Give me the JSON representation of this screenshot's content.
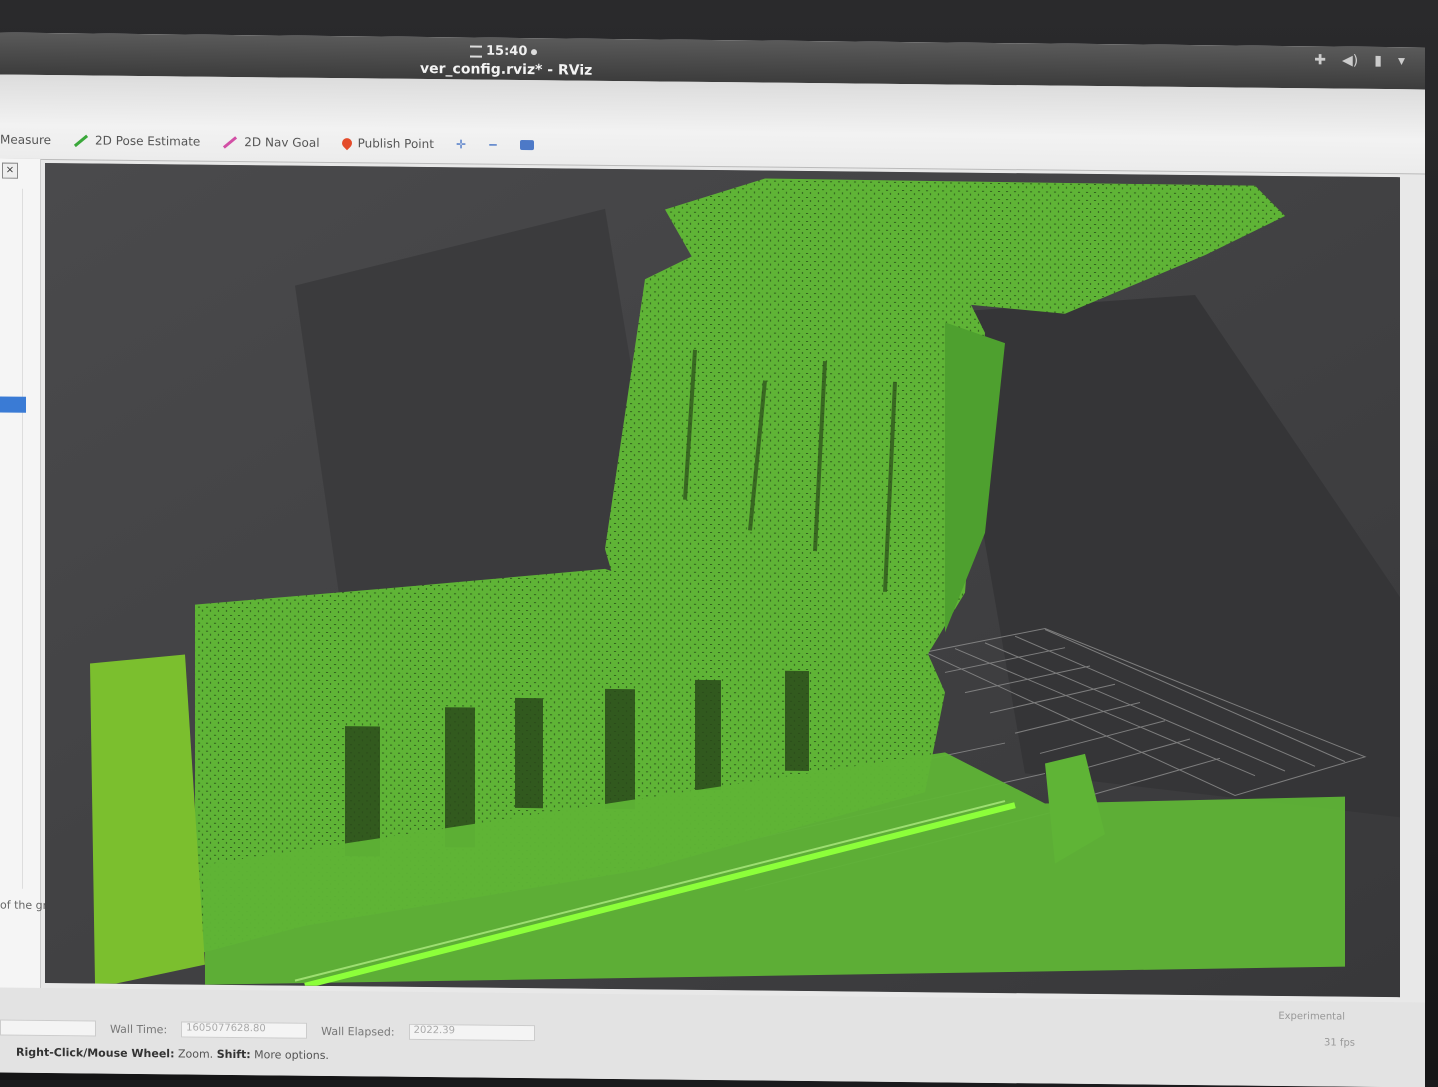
{
  "topbar": {
    "clock": "15:40",
    "window_title": "ver_config.rviz* - RViz"
  },
  "toolbar": {
    "tools": [
      {
        "label": "Measure"
      },
      {
        "label": "2D Pose Estimate"
      },
      {
        "label": "2D Nav Goal"
      },
      {
        "label": "Publish Point"
      }
    ]
  },
  "left_panel": {
    "close_label": "×",
    "help_text": "of the grid"
  },
  "status_bar": {
    "experimental": "Experimental",
    "wall_time_label": "Wall Time:",
    "wall_time_value": "1605077628.80",
    "wall_elapsed_label": "Wall Elapsed:",
    "wall_elapsed_value": "2022.39",
    "fps": "31 fps",
    "hint_bold_1": "Right-Click/Mouse Wheel:",
    "hint_text_1": "Zoom.",
    "hint_bold_2": "Shift:",
    "hint_text_2": "More options."
  },
  "colors": {
    "point_cloud": "#5fb436",
    "trajectory": "#8cff3a",
    "background": "#48484a",
    "grid": "#9a9a9a"
  }
}
